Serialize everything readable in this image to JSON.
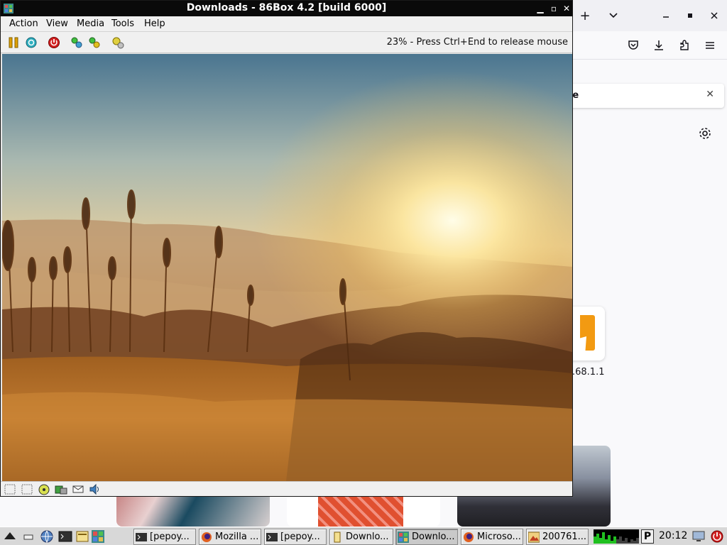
{
  "vm_window": {
    "title": "Downloads - 86Box 4.2 [build 6000]",
    "menu": [
      {
        "label": "Action"
      },
      {
        "label": "View"
      },
      {
        "label": "Media"
      },
      {
        "label": "Tools"
      },
      {
        "label": "Help"
      }
    ],
    "toolbar_icons": [
      "pause-icon",
      "reset-icon",
      "power-icon",
      "ctrl-alt-del-icon",
      "ctrl-alt-esc-icon",
      "settings-icon"
    ],
    "status_message": "23% - Press Ctrl+End to release mouse",
    "statusbar_icons": [
      "floppy-a-icon",
      "floppy-b-icon",
      "cdrom-icon",
      "hdd-icon",
      "network-icon",
      "sound-icon"
    ]
  },
  "browser": {
    "tab_icons": [
      "new-tab-icon",
      "list-all-tabs-icon",
      "minimize-icon",
      "maximize-icon",
      "close-icon"
    ],
    "toolbar_icons": [
      "pocket-icon",
      "downloads-icon",
      "extensions-icon",
      "menu-icon"
    ],
    "search_fragment": "re",
    "shortcut_label": ".68.1.1"
  },
  "taskbar": {
    "tasks": [
      {
        "label": "[pepoy...",
        "icon": "terminal-icon",
        "active": false
      },
      {
        "label": "Mozilla ...",
        "icon": "firefox-icon",
        "active": false
      },
      {
        "label": "[pepoy...",
        "icon": "terminal-icon",
        "active": false
      },
      {
        "label": "Downlo...",
        "icon": "file-manager-icon",
        "active": false
      },
      {
        "label": "Downlo...",
        "icon": "86box-icon",
        "active": true
      },
      {
        "label": "Microso...",
        "icon": "firefox-icon",
        "active": false
      },
      {
        "label": "200761...",
        "icon": "image-viewer-icon",
        "active": false
      }
    ],
    "tray_letter": "P",
    "clock": "20:12"
  },
  "colors": {
    "title_bar": "#0a0a0a",
    "taskbar": "#d8d8d8",
    "firefox_tile_accent": "#f29a12"
  }
}
